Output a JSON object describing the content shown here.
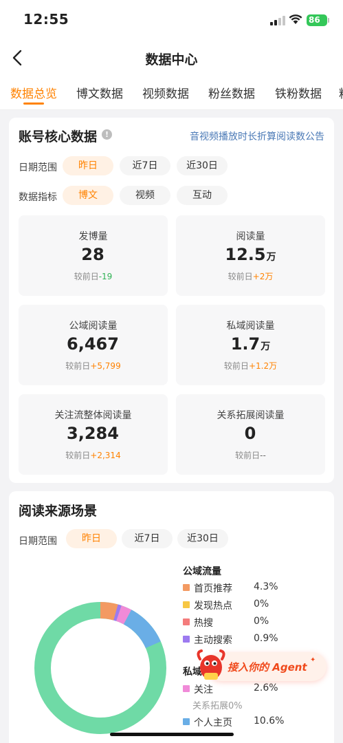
{
  "status_bar": {
    "time": "12:55",
    "battery": "86"
  },
  "nav": {
    "title": "数据中心"
  },
  "tabs": [
    "数据总览",
    "博文数据",
    "视频数据",
    "粉丝数据",
    "铁粉数据",
    "粉"
  ],
  "core": {
    "title": "账号核心数据",
    "notice": "音视频播放时长折算阅读数公告",
    "date_label": "日期范围",
    "date_options": [
      "昨日",
      "近7日",
      "近30日"
    ],
    "metric_label": "数据指标",
    "metric_options": [
      "博文",
      "视频",
      "互动"
    ],
    "stats": [
      {
        "label": "发博量",
        "value": "28",
        "unit": "",
        "compare_prefix": "较前日",
        "change": "-19"
      },
      {
        "label": "阅读量",
        "value": "12.5",
        "unit": "万",
        "compare_prefix": "较前日",
        "change": "+2万"
      },
      {
        "label": "公域阅读量",
        "value": "6,467",
        "unit": "",
        "compare_prefix": "较前日",
        "change": "+5,799"
      },
      {
        "label": "私域阅读量",
        "value": "1.7",
        "unit": "万",
        "compare_prefix": "较前日",
        "change": "+1.2万"
      },
      {
        "label": "关注流整体阅读量",
        "value": "3,284",
        "unit": "",
        "compare_prefix": "较前日",
        "change": "+2,314"
      },
      {
        "label": "关系拓展阅读量",
        "value": "0",
        "unit": "",
        "compare_prefix": "较前日",
        "change": "--"
      }
    ]
  },
  "source": {
    "title": "阅读来源场景",
    "date_label": "日期范围",
    "date_options": [
      "昨日",
      "近7日",
      "近30日"
    ],
    "public_title": "公域流量",
    "private_title": "私域",
    "legend": [
      {
        "name": "首页推荐",
        "value": "4.3%",
        "color": "#f39a62"
      },
      {
        "name": "发现热点",
        "value": "0%",
        "color": "#f7c744"
      },
      {
        "name": "热搜",
        "value": "0%",
        "color": "#f47c7c"
      },
      {
        "name": "主动搜索",
        "value": "0.9%",
        "color": "#9d7af0"
      },
      {
        "name": "关注",
        "value": "2.6%",
        "color": "#f08ad8"
      },
      {
        "name": "个人主页",
        "value": "10.6%",
        "color": "#6aaee6"
      }
    ],
    "sub_note": "关系拓展0%",
    "other_color": "#6fdaa6"
  },
  "agent": {
    "label": "接入你的 Agent"
  },
  "chart_data": {
    "type": "pie",
    "categories": [
      "首页推荐",
      "发现热点",
      "热搜",
      "主动搜索",
      "关注",
      "个人主页"
    ],
    "values": [
      4.3,
      0,
      0,
      0.9,
      2.6,
      10.6
    ]
  }
}
